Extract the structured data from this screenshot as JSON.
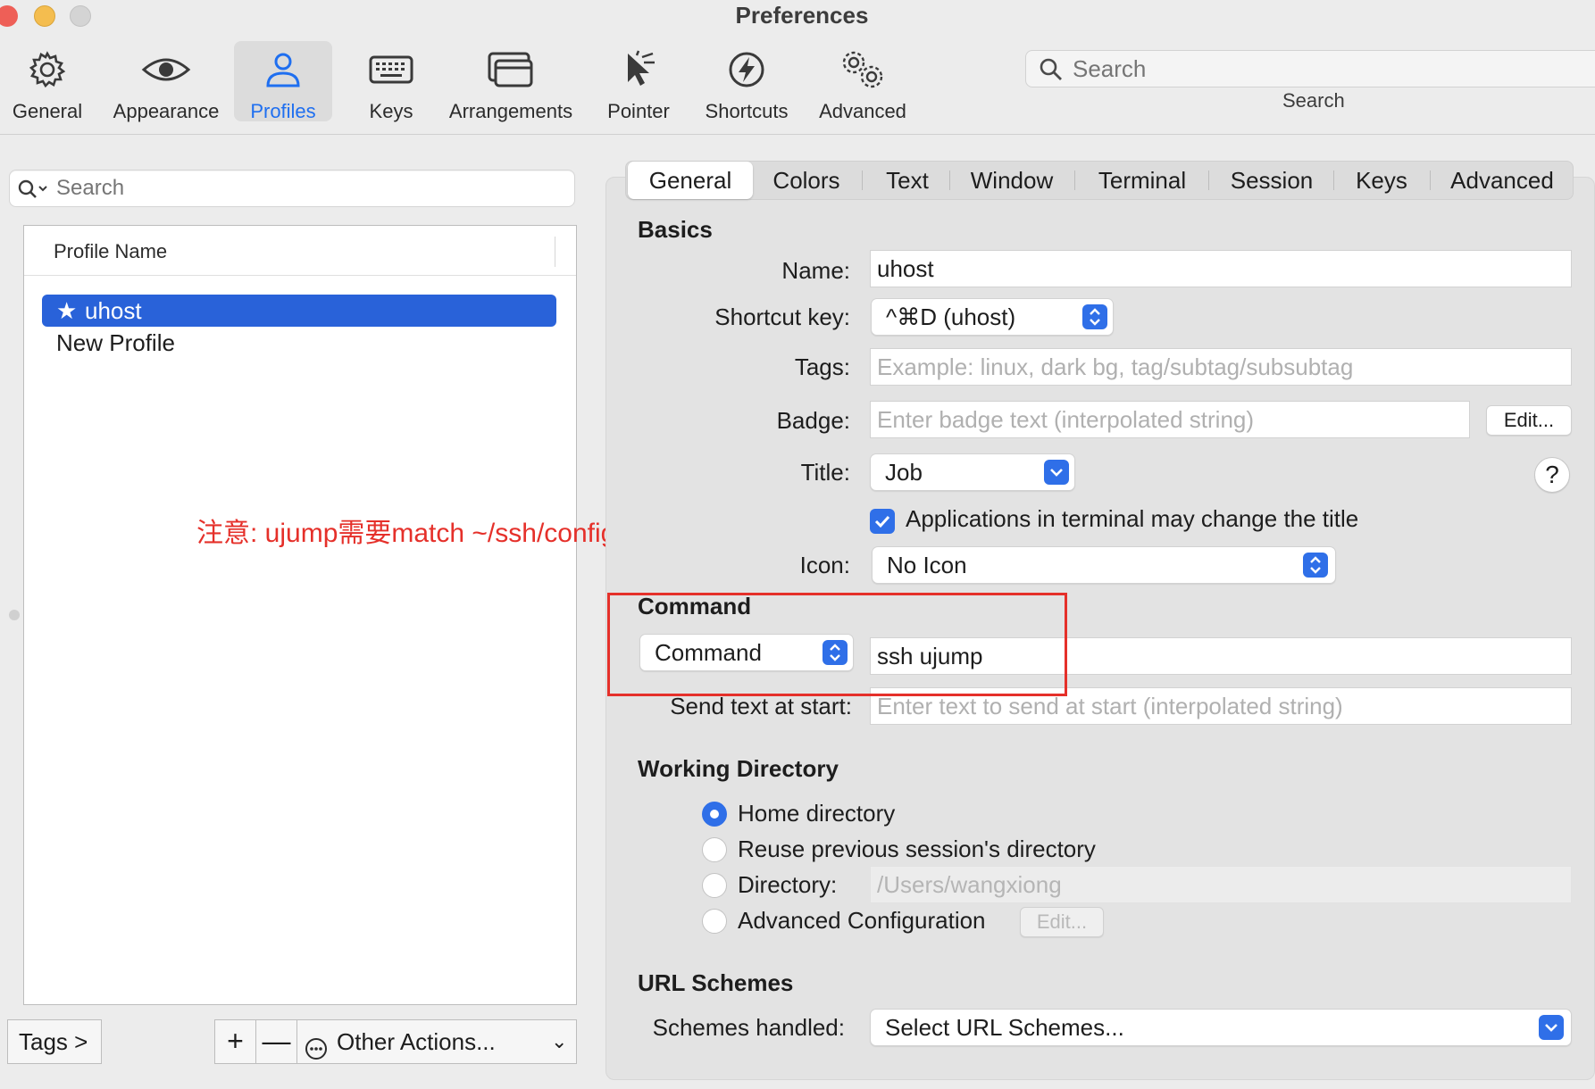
{
  "window": {
    "title": "Preferences"
  },
  "toolbar": {
    "items": [
      {
        "label": "General",
        "icon": "gear-icon"
      },
      {
        "label": "Appearance",
        "icon": "eye-icon"
      },
      {
        "label": "Profiles",
        "icon": "person-icon",
        "active": true
      },
      {
        "label": "Keys",
        "icon": "keyboard-icon"
      },
      {
        "label": "Arrangements",
        "icon": "window-stack-icon"
      },
      {
        "label": "Pointer",
        "icon": "pointer-icon"
      },
      {
        "label": "Shortcuts",
        "icon": "lightning-icon"
      },
      {
        "label": "Advanced",
        "icon": "gears-icon"
      }
    ],
    "search": {
      "placeholder": "Search",
      "label": "Search"
    }
  },
  "left": {
    "search_placeholder": "Search",
    "column_header": "Profile Name",
    "profiles": [
      {
        "name": "uhost",
        "selected": true,
        "default_star": "★"
      },
      {
        "name": "New Profile",
        "selected": false
      }
    ],
    "tags_button": "Tags >",
    "add_button": "+",
    "remove_button": "—",
    "other_actions": "Other Actions...",
    "other_actions_chevron": "⌄"
  },
  "annotation": {
    "text": "注意: ujump需要match ~/ssh/config文件Host",
    "color": "#e5302a"
  },
  "tabs": [
    "General",
    "Colors",
    "Text",
    "Window",
    "Terminal",
    "Session",
    "Keys",
    "Advanced"
  ],
  "basics": {
    "heading": "Basics",
    "name_label": "Name:",
    "name_value": "uhost",
    "shortcut_label": "Shortcut key:",
    "shortcut_value": "^⌘D (uhost)",
    "tags_label": "Tags:",
    "tags_placeholder": "Example: linux, dark bg, tag/subtag/subsubtag",
    "badge_label": "Badge:",
    "badge_placeholder": "Enter badge text (interpolated string)",
    "badge_edit": "Edit...",
    "title_label": "Title:",
    "title_value": "Job",
    "help": "?",
    "apps_change_title": "Applications in terminal may change the title",
    "apps_change_title_checked": true,
    "icon_label": "Icon:",
    "icon_value": "No Icon"
  },
  "command": {
    "heading": "Command",
    "mode_value": "Command",
    "command_value": "ssh ujump",
    "send_text_label": "Send text at start:",
    "send_text_placeholder": "Enter text to send at start (interpolated string)"
  },
  "working_directory": {
    "heading": "Working Directory",
    "options": [
      {
        "label": "Home directory",
        "selected": true
      },
      {
        "label": "Reuse previous session's directory",
        "selected": false
      },
      {
        "label": "Directory:",
        "selected": false
      },
      {
        "label": "Advanced Configuration",
        "selected": false
      }
    ],
    "directory_value": "/Users/wangxiong",
    "advanced_edit": "Edit..."
  },
  "url_schemes": {
    "heading": "URL Schemes",
    "schemes_label": "Schemes handled:",
    "schemes_value": "Select URL Schemes..."
  },
  "colors": {
    "accent": "#2f6fe8",
    "selection": "#2962d9",
    "annotation": "#e5302a"
  }
}
